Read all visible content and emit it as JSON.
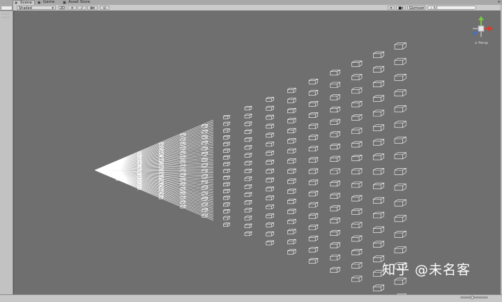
{
  "tabs": [
    {
      "label": "Scene",
      "icon": "scene-icon",
      "active": true
    },
    {
      "label": "Game",
      "icon": "game-icon",
      "active": false
    },
    {
      "label": "Asset Store",
      "icon": "store-icon",
      "active": false
    }
  ],
  "toolbar": {
    "shading_mode": "Shaded",
    "mode_2d": "2D",
    "gizmos_label": "Gizmos",
    "search_placeholder": "All"
  },
  "scene": {
    "perspective_label": "≤ Persp"
  },
  "watermark": "知乎 @未名客",
  "colors": {
    "viewport_bg": "#6f6f6f",
    "wire": "#ffffff",
    "gizmo_x": "#d63b2f",
    "gizmo_y": "#7ac943",
    "gizmo_z": "#3f6fd6"
  }
}
